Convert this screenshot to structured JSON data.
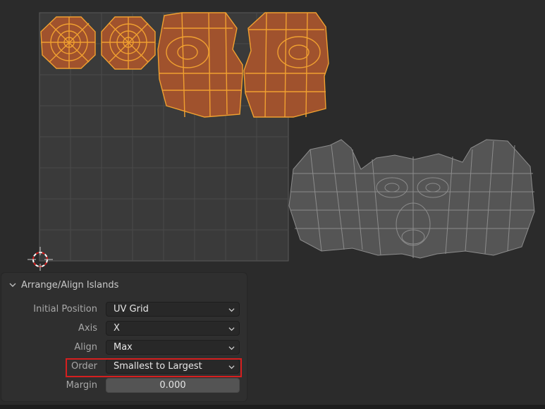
{
  "panel": {
    "title": "Arrange/Align Islands",
    "fields": [
      {
        "label": "Initial Position",
        "value": "UV Grid",
        "kind": "dropdown"
      },
      {
        "label": "Axis",
        "value": "X",
        "kind": "dropdown"
      },
      {
        "label": "Align",
        "value": "Max",
        "kind": "dropdown"
      },
      {
        "label": "Order",
        "value": "Smallest to Largest",
        "kind": "dropdown"
      },
      {
        "label": "Margin",
        "value": "0.000",
        "kind": "number"
      }
    ]
  },
  "colors": {
    "selected_island_fill": "#a0522d",
    "selected_island_edge": "#f0a030",
    "unselected_island_fill": "#555555",
    "unselected_island_edge": "#8c8c8c",
    "highlight_box": "#d61f1f"
  },
  "icons": {
    "cursor": "2d-cursor-icon",
    "collapse": "chevron-down-icon",
    "dropdown": "chevron-down-icon"
  }
}
